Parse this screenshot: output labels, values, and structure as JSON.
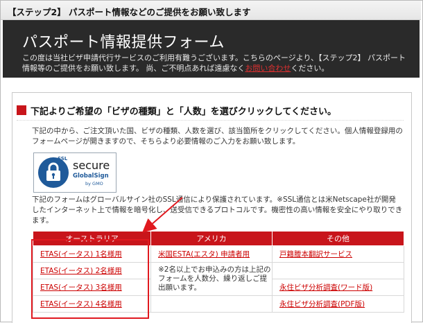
{
  "step_bar": {
    "title": "【ステップ2】 パスポート情報などのご提供をお願い致します"
  },
  "header": {
    "form_title": "パスポート情報提供フォーム",
    "intro_part1": "この度は当社ビザ申請代行サービスのご利用有難うございます。こちらのページより、【ステップ2】 パスポート情報等のご提供をお願い致します。 尚、ご不明点あれば遠慮なく",
    "intro_link": "お問い合わせ",
    "intro_part2": "ください。"
  },
  "section": {
    "title": "下記よりご希望の「ビザの種類」と「人数」を選びクリックしてください。",
    "description": "下記の中から、ご注文頂いた国、ビザの種類、人数を選び、該当箇所をクリックしてください。個人情報登録用のフォームページが開きますので、そちらより必要情報のご入力をお願い致します。",
    "ssl_text": "下記のフォームはグローバルサイン社のSSL通信により保護されています。※SSL通信とは米Netscape社が開発したインターネット上で情報を暗号化し、送受信できるプロトコルです。機密性の高い情報を安全にやり取りできます。"
  },
  "ssl_badge": {
    "tag": "SSL",
    "secure": "secure",
    "globalsign": "GlobalSign",
    "gmo": "by GMO"
  },
  "table": {
    "headers": [
      "オーストラリア",
      "アメリカ",
      "その他"
    ],
    "australia": [
      "ETAS(イータス) 1名様用",
      "ETAS(イータス) 2名様用",
      "ETAS(イータス) 3名様用",
      "ETAS(イータス) 4名様用"
    ],
    "america_link": "米国ESTA(エスタ) 申請者用",
    "america_note": "※2名以上でお申込みの方は上記のフォームを人数分、繰り返しご提出願います。",
    "other": [
      "戸籍謄本翻訳サービス",
      "永住ビザ分析調査(ワード版)",
      "永住ビザ分析調査(PDF版)"
    ]
  },
  "colors": {
    "accent": "#c8151b",
    "header_bg": "#2a2a2a",
    "link": "#cc0000",
    "annotation": "#e0191f"
  }
}
